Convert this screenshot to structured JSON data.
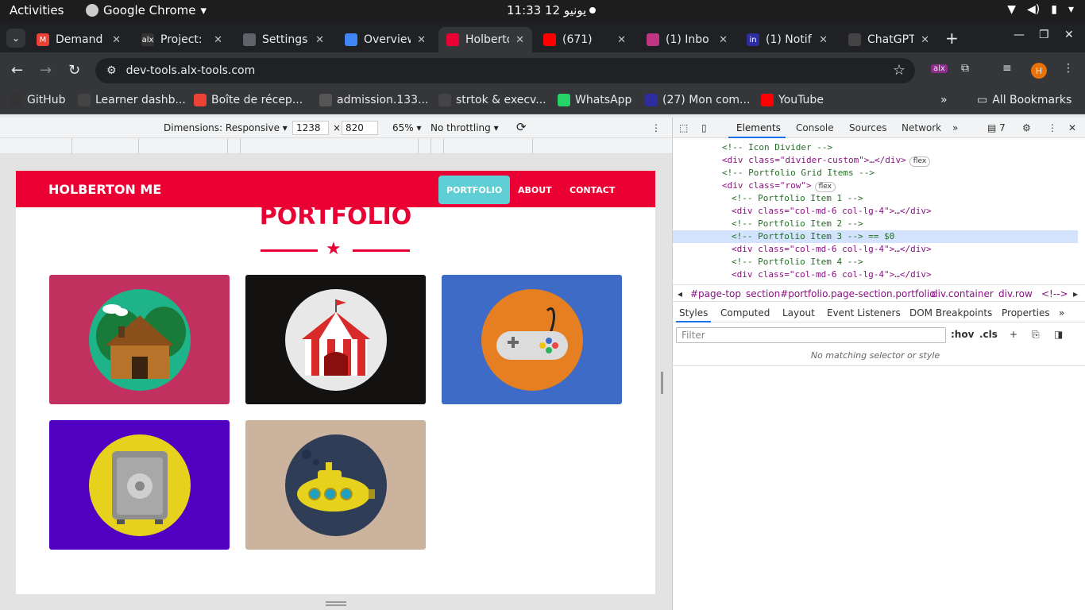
{
  "os": {
    "activities": "Activities",
    "app_name": "Google Chrome",
    "clock": "11:33  12 يونيو"
  },
  "tabs": [
    {
      "title": "Demand",
      "favicon_color": "#ea4335",
      "favicon": "M"
    },
    {
      "title": "Project:",
      "favicon_color": "#333333",
      "favicon": "alx"
    },
    {
      "title": "Settings",
      "favicon_color": "#5f6368",
      "favicon": "book-icon"
    },
    {
      "title": "Overview",
      "favicon_color": "#4285f4",
      "favicon": "chrome-icon"
    },
    {
      "title": "Holberto",
      "favicon_color": "#ea0033",
      "favicon": "holberton-icon"
    },
    {
      "title": "(671)",
      "favicon_color": "#ff0000",
      "favicon": "youtube-icon"
    },
    {
      "title": "(1) Inbo",
      "favicon_color": "#c13584",
      "favicon": "instagram-icon"
    },
    {
      "title": "(1) Notif",
      "favicon_color": "#2d2d9f",
      "favicon": "in"
    },
    {
      "title": "ChatGPT",
      "favicon_color": "#444444",
      "favicon": "chatgpt-icon"
    }
  ],
  "address": {
    "url": "dev-tools.alx-tools.com"
  },
  "bookmarks": [
    {
      "label": "GitHub",
      "color": "#333333"
    },
    {
      "label": "Learner dashb...",
      "color": "#444444"
    },
    {
      "label": "Boîte de récep...",
      "color": "#ea4335"
    },
    {
      "label": "admission.133...",
      "color": "#555555"
    },
    {
      "label": "strtok & execv...",
      "color": "#444444"
    },
    {
      "label": "WhatsApp",
      "color": "#25d366"
    },
    {
      "label": "(27) Mon com...",
      "color": "#2d2d9f"
    },
    {
      "label": "YouTube",
      "color": "#ff0000"
    }
  ],
  "all_bookmarks": "All Bookmarks",
  "device_toolbar": {
    "dimensions": "Dimensions: Responsive",
    "width": "1238",
    "times": "×",
    "height": "820",
    "zoom": "65%",
    "throttle": "No throttling"
  },
  "site": {
    "brand": "HOLBERTON ME",
    "nav": [
      "PORTFOLIO",
      "ABOUT",
      "CONTACT"
    ],
    "title": "PORTFOLIO",
    "colors": {
      "primary": "#ea0033",
      "accent": "#5fcfd5"
    },
    "tiles": [
      {
        "name": "cabin",
        "bg": "#c2305f",
        "circle": "#1fb38a"
      },
      {
        "name": "circus",
        "bg": "#141111",
        "circle": "#e8e8e8"
      },
      {
        "name": "game",
        "bg": "#3d6bc5",
        "circle": "#e67e22"
      },
      {
        "name": "safe",
        "bg": "#5000c0",
        "circle": "#e6d21c"
      },
      {
        "name": "submarine",
        "bg": "#cbb39e",
        "circle": "#2f3e56"
      }
    ]
  },
  "devtools": {
    "tabs": [
      "Elements",
      "Console",
      "Sources",
      "Network"
    ],
    "issues": "7",
    "dom": [
      {
        "indent": 1,
        "html": "<!-- Icon Divider -->"
      },
      {
        "indent": 1,
        "html": "<div class=\"divider-custom\">…</div>",
        "badge": "flex"
      },
      {
        "indent": 1,
        "html": "<!-- Portfolio Grid Items -->"
      },
      {
        "indent": 1,
        "html": "<div class=\"row\">",
        "badge": "flex"
      },
      {
        "indent": 2,
        "html": "<!-- Portfolio Item 1 -->"
      },
      {
        "indent": 2,
        "html": "<div class=\"col-md-6 col-lg-4\">…</div>"
      },
      {
        "indent": 2,
        "html": "<!-- Portfolio Item 2 -->"
      },
      {
        "indent": 2,
        "html": "<!-- Portfolio Item 3 --> == $0",
        "selected": true
      },
      {
        "indent": 2,
        "html": "<div class=\"col-md-6 col-lg-4\">…</div>"
      },
      {
        "indent": 2,
        "html": "<!-- Portfolio Item 4 -->"
      },
      {
        "indent": 2,
        "html": "<div class=\"col-md-6 col-lg-4\">…</div>"
      }
    ],
    "breadcrumbs": [
      "#page-top",
      "section#portfolio.page-section.portfolio",
      "div.container",
      "div.row",
      "<!-->"
    ],
    "subtabs": [
      "Styles",
      "Computed",
      "Layout",
      "Event Listeners",
      "DOM Breakpoints",
      "Properties"
    ],
    "filter_placeholder": "Filter",
    "hov": ":hov",
    "cls": ".cls",
    "no_match": "No matching selector or style"
  }
}
